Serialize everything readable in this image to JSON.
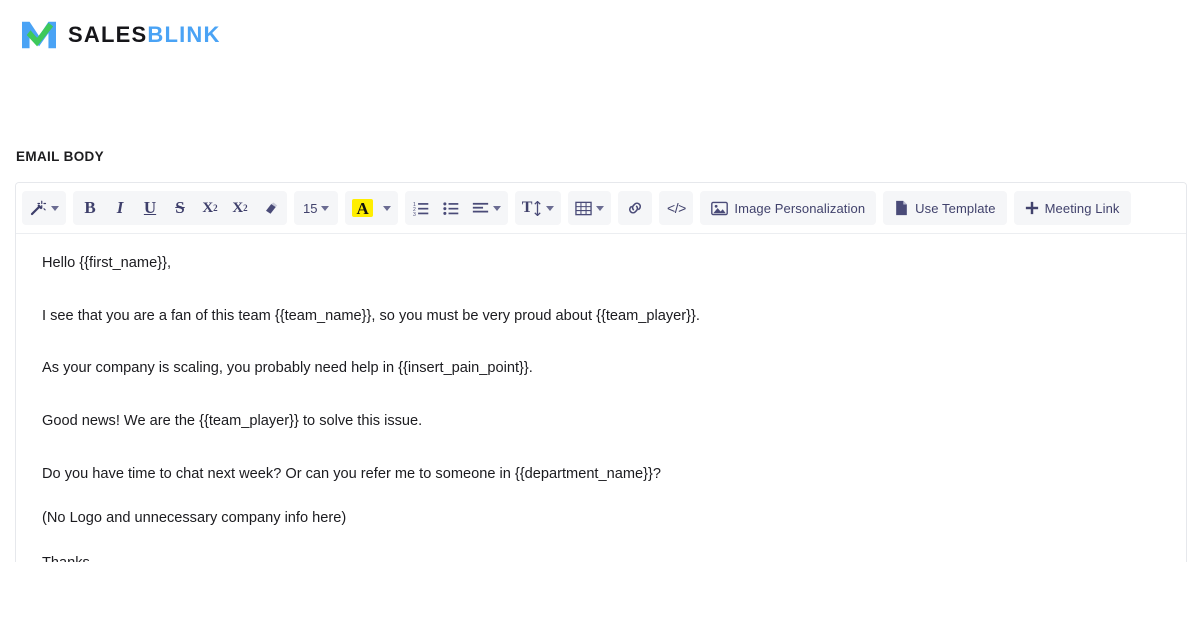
{
  "brand": {
    "name_part1": "SALES",
    "name_part2": "BLINK",
    "logo_icon": "salesblink-checkmark-logo",
    "blue": "#4aa3f5",
    "green": "#3ec95a",
    "dark": "#16161a"
  },
  "section": {
    "label": "EMAIL BODY"
  },
  "toolbar": {
    "magic_wand": {
      "icon": "magic-wand-icon",
      "label": ""
    },
    "bold": "B",
    "italic": "I",
    "underline": "U",
    "strikethrough": "S",
    "superscript_base": "X",
    "superscript_exp": "2",
    "subscript_base": "X",
    "subscript_exp": "2",
    "eraser": {
      "icon": "eraser-icon"
    },
    "font_size": "15",
    "text_color_letter": "A",
    "text_color_highlight": "#ffee00",
    "ordered_list": {
      "icon": "ordered-list-icon"
    },
    "unordered_list": {
      "icon": "unordered-list-icon"
    },
    "align": {
      "icon": "align-left-icon"
    },
    "line_height": {
      "icon": "line-height-icon",
      "letter": "T"
    },
    "table": {
      "icon": "table-icon"
    },
    "link": {
      "icon": "link-icon"
    },
    "code": {
      "icon": "code-icon",
      "glyph": "</>"
    },
    "image_personalization": {
      "icon": "image-icon",
      "label": "Image Personalization"
    },
    "use_template": {
      "icon": "document-icon",
      "label": "Use Template"
    },
    "meeting_link": {
      "icon": "plus-icon",
      "label": "Meeting Link"
    },
    "icon_color": "#3e3f6b",
    "group_bg": "#f5f6f8"
  },
  "email_body": {
    "paragraphs": [
      "Hello {{first_name}},",
      "I see that you are a fan of this team {{team_name}}, so you must be very proud about {{team_player}}.",
      "As your company is scaling, you probably need help in {{insert_pain_point}}.",
      "Good news! We are the {{team_player}} to solve this issue.",
      "Do you have time to chat next week? Or can you refer me to someone in {{department_name}}?",
      "(No Logo and unnecessary company info here)",
      "Thanks"
    ]
  }
}
